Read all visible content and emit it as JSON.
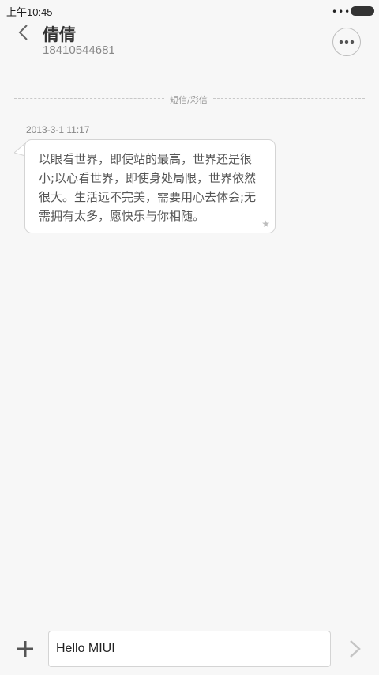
{
  "status_bar": {
    "time": "上午10:45",
    "signal_dots": "•••"
  },
  "header": {
    "contact_name": "倩倩",
    "contact_number": "18410544681"
  },
  "conversation": {
    "channel_label": "短信/彩信",
    "messages": [
      {
        "timestamp": "2013-3-1 11:17",
        "text": "以眼看世界，即使站的最高，世界还是很小;以心看世界，即使身处局限，世界依然很大。生活远不完美，需要用心去体会;无需拥有太多，愿快乐与你相随。",
        "starred_icon": "★"
      }
    ]
  },
  "composer": {
    "value": "Hello MIUI"
  },
  "icons": {
    "back": "chevron-left-icon",
    "more": "more-horizontal-icon",
    "add": "plus-icon",
    "send": "chevron-right-icon",
    "star": "star-icon",
    "battery": "battery-icon"
  },
  "colors": {
    "background": "#f7f7f7",
    "bubble": "#ffffff",
    "text_primary": "#333333",
    "text_secondary": "#888888"
  }
}
